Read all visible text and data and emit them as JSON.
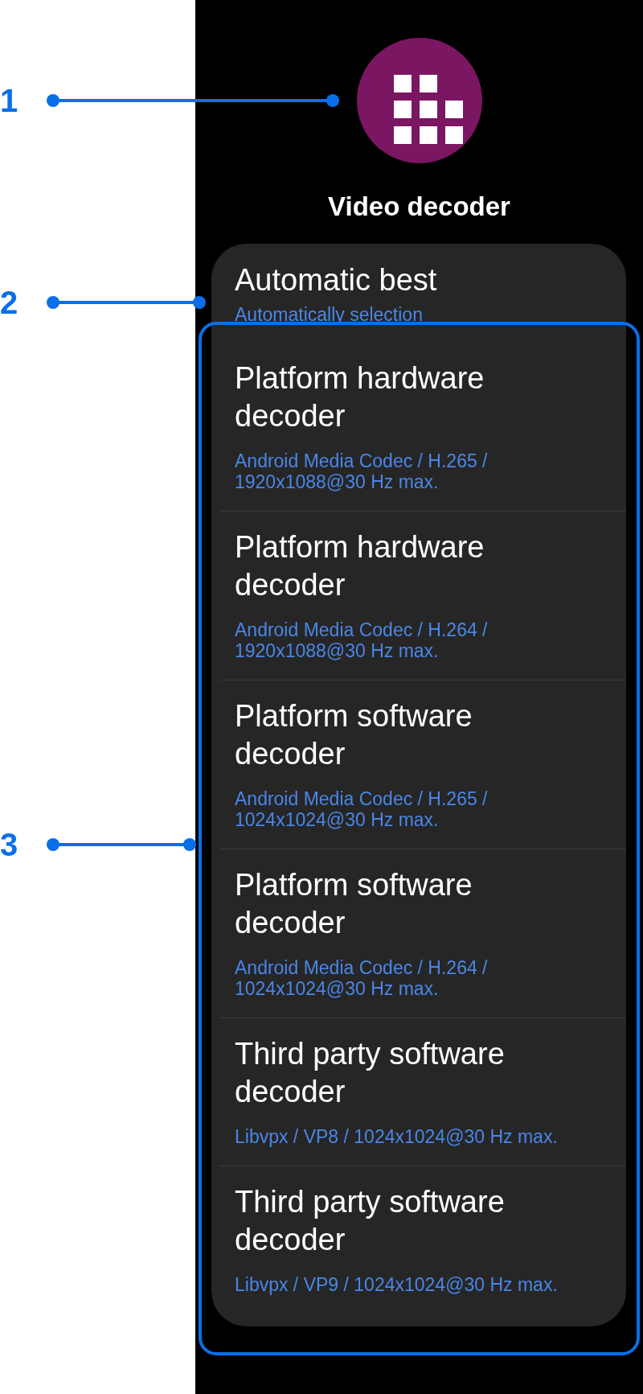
{
  "callouts": [
    {
      "label": "1"
    },
    {
      "label": "2"
    },
    {
      "label": "3"
    }
  ],
  "dialog": {
    "title": "Video decoder",
    "options": [
      {
        "title": "Automatic best",
        "subtitle": "Automatically selection"
      },
      {
        "title": "Platform hardware decoder",
        "subtitle": "Android Media Codec / H.265 / 1920x1088@30 Hz max."
      },
      {
        "title": "Platform hardware decoder",
        "subtitle": "Android Media Codec / H.264 / 1920x1088@30 Hz max."
      },
      {
        "title": "Platform software decoder",
        "subtitle": "Android Media Codec / H.265 / 1024x1024@30 Hz max."
      },
      {
        "title": "Platform software decoder",
        "subtitle": "Android Media Codec / H.264 / 1024x1024@30 Hz max."
      },
      {
        "title": "Third party software decoder",
        "subtitle": "Libvpx / VP8 / 1024x1024@30 Hz max."
      },
      {
        "title": "Third party software decoder",
        "subtitle": "Libvpx / VP9 / 1024x1024@30 Hz max."
      }
    ]
  }
}
